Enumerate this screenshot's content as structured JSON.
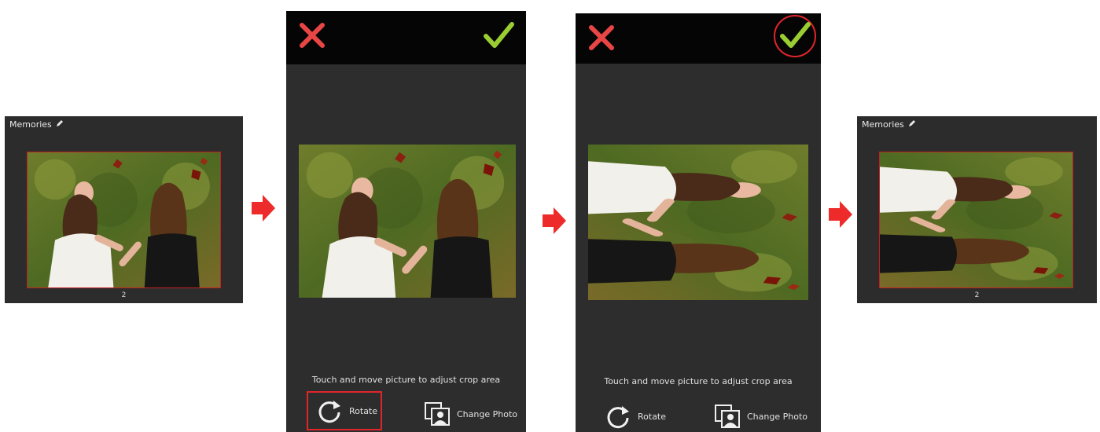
{
  "album_before": {
    "title": "Memories",
    "page": "2"
  },
  "album_after": {
    "title": "Memories",
    "page": "2"
  },
  "crop_screen_1": {
    "hint": "Touch and move picture to adjust crop area",
    "rotate_label": "Rotate",
    "change_photo_label": "Change Photo"
  },
  "crop_screen_2": {
    "hint": "Touch and move picture to adjust crop area",
    "rotate_label": "Rotate",
    "change_photo_label": "Change Photo"
  },
  "colors": {
    "cancel": "#e84545",
    "confirm": "#9acd32",
    "highlight": "#e0252b",
    "arrow": "#ee2b2b",
    "panel": "#2d2d2d"
  },
  "icons": [
    "close-icon",
    "check-icon",
    "pencil-icon",
    "rotate-icon",
    "change-photo-icon",
    "arrow-right-icon"
  ]
}
